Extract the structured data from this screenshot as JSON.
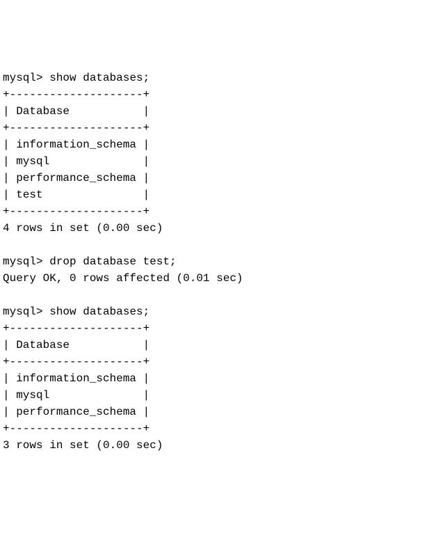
{
  "session": {
    "prompt": "mysql>",
    "commands": [
      {
        "cmd": "show databases;",
        "table": {
          "border_top": "+--------------------+",
          "header_line": "| Database           |",
          "border_mid": "+--------------------+",
          "rows": [
            "| information_schema |",
            "| mysql              |",
            "| performance_schema |",
            "| test               |"
          ],
          "border_bot": "+--------------------+"
        },
        "result": "4 rows in set (0.00 sec)"
      },
      {
        "cmd": "drop database test;",
        "result": "Query OK, 0 rows affected (0.01 sec)"
      },
      {
        "cmd": "show databases;",
        "table": {
          "border_top": "+--------------------+",
          "header_line": "| Database           |",
          "border_mid": "+--------------------+",
          "rows": [
            "| information_schema |",
            "| mysql              |",
            "| performance_schema |"
          ],
          "border_bot": "+--------------------+"
        },
        "result": "3 rows in set (0.00 sec)"
      }
    ]
  }
}
